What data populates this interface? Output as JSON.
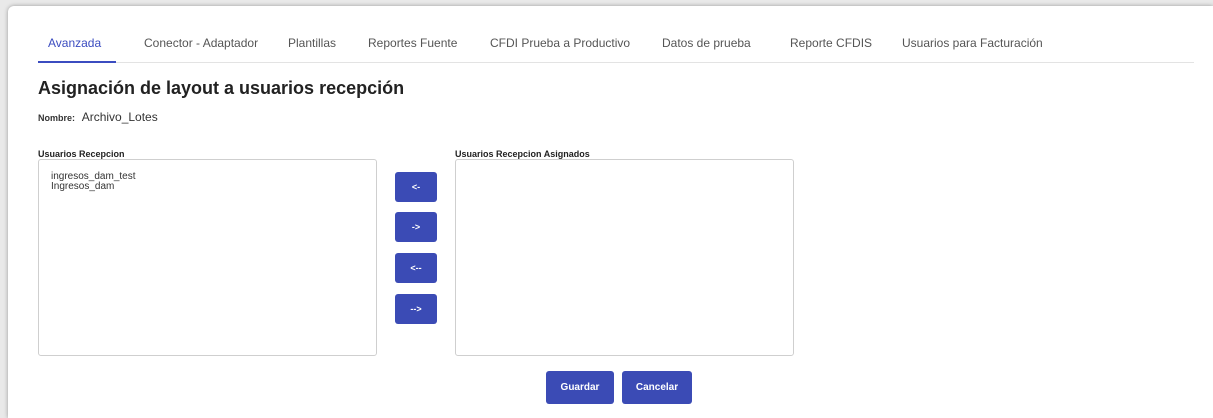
{
  "tabs": [
    {
      "label": "Avanzada"
    },
    {
      "label": "Conector - Adaptador"
    },
    {
      "label": "Plantillas"
    },
    {
      "label": "Reportes Fuente"
    },
    {
      "label": "CFDI Prueba a Productivo"
    },
    {
      "label": "Datos de prueba"
    },
    {
      "label": "Reporte CFDIS"
    },
    {
      "label": "Usuarios para Facturación"
    }
  ],
  "page": {
    "title": "Asignación de layout a usuarios recepción",
    "name_label": "Nombre:",
    "name_value": "Archivo_Lotes"
  },
  "available": {
    "label": "Usuarios Recepcion",
    "items": [
      "ingresos_dam_test",
      "Ingresos_dam"
    ]
  },
  "assigned": {
    "label": "Usuarios Recepcion Asignados",
    "items": []
  },
  "move_buttons": {
    "left_one": "<-",
    "right_one": "->",
    "left_all": "<--",
    "right_all": "-->"
  },
  "actions": {
    "save": "Guardar",
    "cancel": "Cancelar"
  },
  "colors": {
    "accent": "#3b4cc0",
    "button": "#3b4bb5"
  }
}
